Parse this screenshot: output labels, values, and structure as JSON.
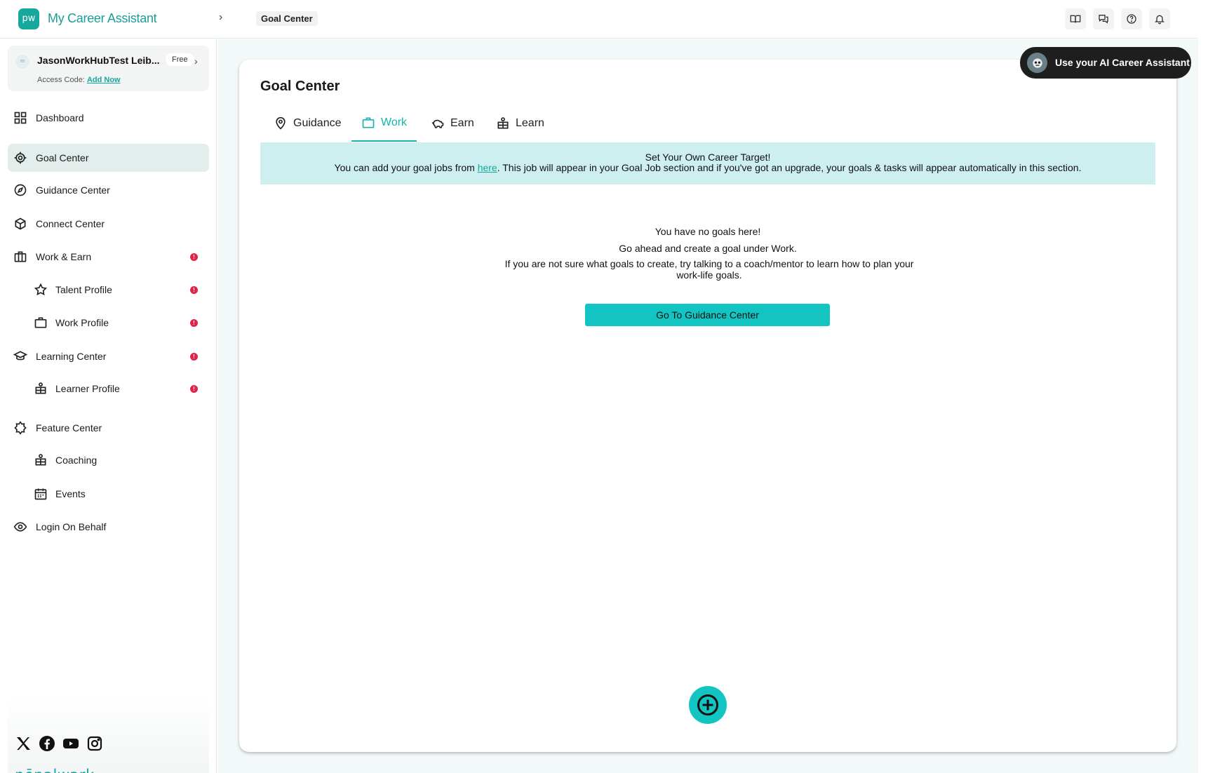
{
  "topbar": {
    "logo_text": "pw",
    "app_title": "My Career Assistant",
    "breadcrumb": "Goal Center",
    "icons": [
      "book-icon",
      "chat-icon",
      "help-icon",
      "bell-icon"
    ]
  },
  "account": {
    "avatar_text": "m",
    "name": "JasonWorkHubTest Leib...",
    "plan": "Free",
    "access_code_label": "Access Code:",
    "access_code_link": "Add Now"
  },
  "sidebar": {
    "items": [
      {
        "label": "Dashboard",
        "icon": "grid-icon"
      },
      {
        "label": "Goal Center",
        "icon": "target-icon",
        "active": true
      },
      {
        "label": "Guidance Center",
        "icon": "compass-icon"
      },
      {
        "label": "Connect Center",
        "icon": "cube-icon"
      },
      {
        "label": "Work & Earn",
        "icon": "building-icon",
        "alert": "!"
      },
      {
        "label": "Talent Profile",
        "icon": "star-icon",
        "alert": "!",
        "sub": true
      },
      {
        "label": "Work Profile",
        "icon": "briefcase-icon",
        "alert": "!",
        "sub": true
      },
      {
        "label": "Learning Center",
        "icon": "graduation-icon",
        "alert": "!"
      },
      {
        "label": "Learner Profile",
        "icon": "person-board-icon",
        "alert": "!",
        "sub": true
      },
      {
        "label": "Feature Center",
        "icon": "badge-icon"
      },
      {
        "label": "Coaching",
        "icon": "coach-icon",
        "sub": true
      },
      {
        "label": "Events",
        "icon": "calendar-icon",
        "sub": true
      },
      {
        "label": "Login On Behalf",
        "icon": "eye-icon"
      }
    ],
    "social": [
      "x-icon",
      "facebook-icon",
      "youtube-icon",
      "instagram-icon"
    ],
    "brand": "pēpəlwərk"
  },
  "main": {
    "title": "Goal Center",
    "tabs": [
      {
        "label": "Guidance",
        "icon": "location-pin-icon"
      },
      {
        "label": "Work",
        "icon": "briefcase-icon",
        "active": true
      },
      {
        "label": "Earn",
        "icon": "piggy-bank-icon"
      },
      {
        "label": "Learn",
        "icon": "learner-icon"
      }
    ],
    "banner": {
      "title": "Set Your Own Career Target!",
      "text_before": "You can add your goal jobs from ",
      "link": "here",
      "text_after": ". This job will appear in your Goal Job section and if you've got an upgrade, your goals & tasks will appear automatically in this section."
    },
    "empty": {
      "line1": "You have no goals here!",
      "line2": "Go ahead and create a goal under Work.",
      "line3": "If you are not sure what goals to create, try talking to a coach/mentor to learn how to plan your work-life goals."
    },
    "cta": "Go To Guidance Center"
  },
  "ai_assistant": {
    "label": "Use your AI Career Assistant"
  },
  "colors": {
    "accent": "#17b3ad",
    "button": "#12c4c2",
    "alert": "#e0244a",
    "banner": "#cdeff0"
  }
}
